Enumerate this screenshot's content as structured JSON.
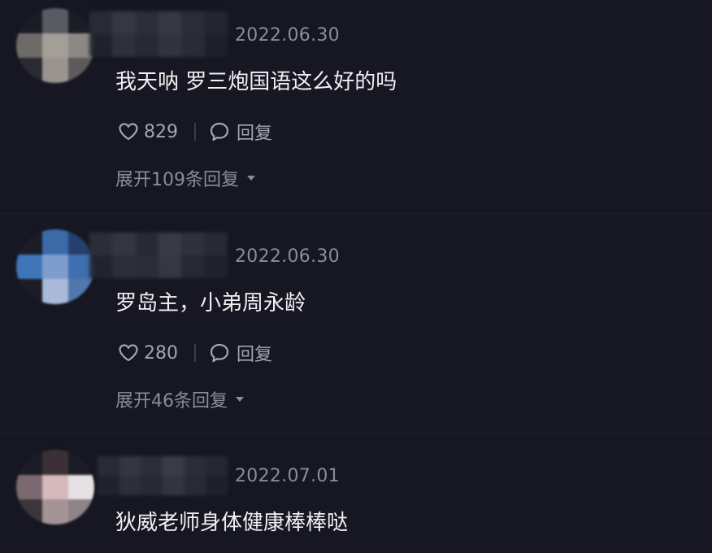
{
  "comments": [
    {
      "date": "2022.06.30",
      "text": "我天呐 罗三炮国语这么好的吗",
      "likes": "829",
      "reply_label": "回复",
      "expand_label": "展开109条回复",
      "avatar_colors": [
        "#1b1c26",
        "#5a5a62",
        "#1b1c26",
        "#6e6a68",
        "#a39e98",
        "#8c8884",
        "#2a2a30",
        "#9a9490",
        "#5c5a5a"
      ],
      "username_colors": [
        "#2c2d38",
        "#3a3b45",
        "#30313b",
        "#3b3c46",
        "#2e2f39",
        "#262731",
        "#22232d",
        "#32333d",
        "#2a2b35",
        "#363741",
        "#2d2e38",
        "#20212b"
      ]
    },
    {
      "date": "2022.06.30",
      "text": "罗岛主，小弟周永龄",
      "likes": "280",
      "reply_label": "回复",
      "expand_label": "展开46条回复",
      "avatar_colors": [
        "#1b1c26",
        "#3c6aa8",
        "#25406e",
        "#3e76b8",
        "#7e9ccc",
        "#3f6fb0",
        "#1b1c26",
        "#a9bad8",
        "#5178ae"
      ],
      "username_colors": [
        "#2f303a",
        "#383944",
        "#2b2c36",
        "#3d3e48",
        "#33343e",
        "#2a2b35",
        "#24252f",
        "#30313b",
        "#2e2f39",
        "#3a3b45",
        "#292a34",
        "#22232d"
      ]
    },
    {
      "date": "2022.07.01",
      "text": "狄威老师身体健康棒棒哒",
      "likes": "",
      "reply_label": "",
      "expand_label": "",
      "avatar_colors": [
        "#1b1c26",
        "#3a3036",
        "#1b1c26",
        "#7c6a70",
        "#d4b8bc",
        "#e6e2e4",
        "#3c353b",
        "#a59497",
        "#8e8386"
      ],
      "username_colors": [
        "#2c2d37",
        "#383943",
        "#30313b",
        "#3e3f49",
        "#2e2f39",
        "#272832",
        "#23242e",
        "#31323c",
        "#2b2c36",
        "#373842",
        "#2c2d37",
        "#21222c"
      ]
    }
  ],
  "colors": {
    "background": "#161722",
    "primary_text": "#f0f0f2",
    "secondary_text": "#8b8c96",
    "action_text": "#a4a5ae"
  },
  "icons": {
    "like": "heart-outline-icon",
    "reply": "speech-bubble-icon",
    "expand": "caret-down-icon"
  }
}
